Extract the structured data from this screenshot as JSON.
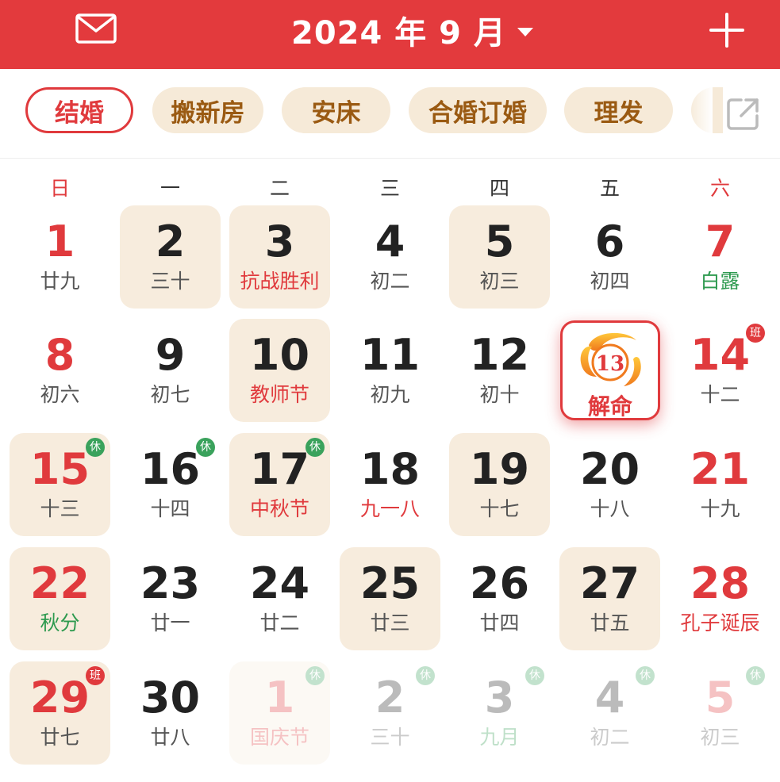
{
  "header": {
    "title": "2024 年 9 月",
    "mail_icon": "mail-icon",
    "dropdown_icon": "caret-down-icon",
    "add_icon": "plus-icon",
    "color": "#e33a3d"
  },
  "tags": [
    "结婚",
    "搬新房",
    "安床",
    "合婚订婚",
    "理发"
  ],
  "tags_active": "结婚",
  "external_icon": "external-link-icon",
  "weekdays": [
    "日",
    "一",
    "二",
    "三",
    "四",
    "五",
    "六"
  ],
  "today": {
    "day": "13",
    "label": "解命"
  },
  "days": [
    {
      "d": "1",
      "l": "廿九"
    },
    {
      "d": "2",
      "l": "三十"
    },
    {
      "d": "3",
      "l": "抗战胜利"
    },
    {
      "d": "4",
      "l": "初二"
    },
    {
      "d": "5",
      "l": "初三"
    },
    {
      "d": "6",
      "l": "初四"
    },
    {
      "d": "7",
      "l": "白露"
    },
    {
      "d": "8",
      "l": "初六"
    },
    {
      "d": "9",
      "l": "初七"
    },
    {
      "d": "10",
      "l": "教师节"
    },
    {
      "d": "11",
      "l": "初九"
    },
    {
      "d": "12",
      "l": "初十"
    },
    {
      "d": "13",
      "l": "解命"
    },
    {
      "d": "14",
      "l": "十二",
      "badge": "班"
    },
    {
      "d": "15",
      "l": "十三",
      "badge": "休"
    },
    {
      "d": "16",
      "l": "十四",
      "badge": "休"
    },
    {
      "d": "17",
      "l": "中秋节",
      "badge": "休"
    },
    {
      "d": "18",
      "l": "九一八"
    },
    {
      "d": "19",
      "l": "十七"
    },
    {
      "d": "20",
      "l": "十八"
    },
    {
      "d": "21",
      "l": "十九"
    },
    {
      "d": "22",
      "l": "秋分"
    },
    {
      "d": "23",
      "l": "廿一"
    },
    {
      "d": "24",
      "l": "廿二"
    },
    {
      "d": "25",
      "l": "廿三"
    },
    {
      "d": "26",
      "l": "廿四"
    },
    {
      "d": "27",
      "l": "廿五"
    },
    {
      "d": "28",
      "l": "孔子诞辰"
    },
    {
      "d": "29",
      "l": "廿七",
      "badge": "班"
    },
    {
      "d": "30",
      "l": "廿八"
    },
    {
      "d": "1",
      "l": "国庆节",
      "badge": "休"
    },
    {
      "d": "2",
      "l": "三十",
      "badge": "休"
    },
    {
      "d": "3",
      "l": "九月",
      "badge": "休"
    },
    {
      "d": "4",
      "l": "初二",
      "badge": "休"
    },
    {
      "d": "5",
      "l": "初三",
      "badge": "休"
    }
  ]
}
